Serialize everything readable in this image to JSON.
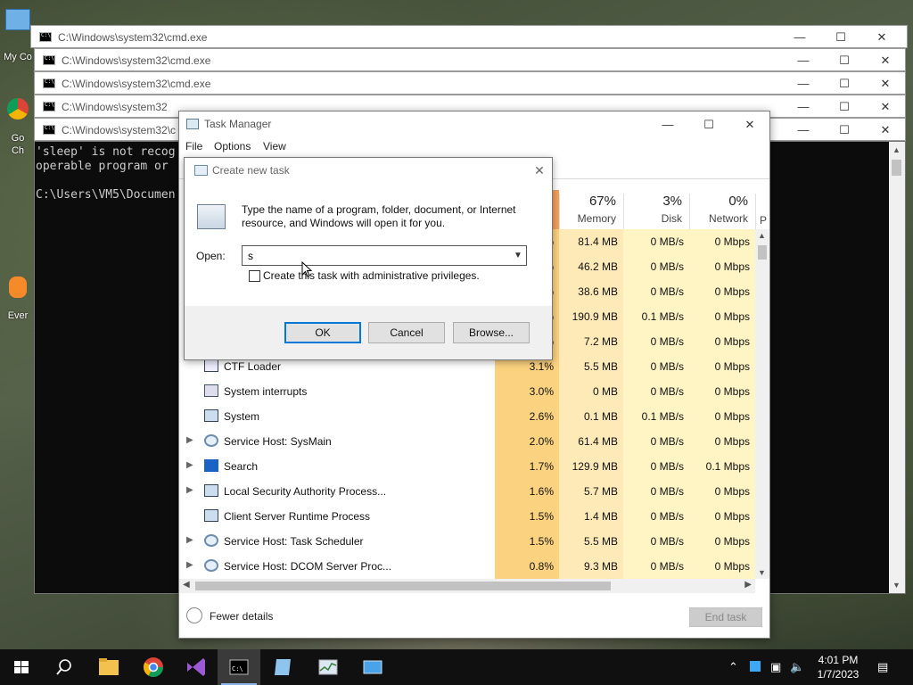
{
  "desktop": {
    "icons": [
      {
        "label": "My Co"
      },
      {
        "label": "Go\nCh"
      },
      {
        "label": "Ever"
      }
    ]
  },
  "cmd_windows": [
    {
      "title": "C:\\Windows\\system32\\cmd.exe"
    },
    {
      "title": "C:\\Windows\\system32\\cmd.exe"
    },
    {
      "title": "C:\\Windows\\system32\\cmd.exe"
    },
    {
      "title": "C:\\Windows\\system32"
    },
    {
      "title": "C:\\Windows\\system32\\c"
    }
  ],
  "cmd_output": {
    "line1": "'sleep' is not recog",
    "line2": "operable program or",
    "line3": "C:\\Users\\VM5\\Documen"
  },
  "task_manager": {
    "title": "Task Manager",
    "menu": [
      "File",
      "Options",
      "View"
    ],
    "columns": {
      "memory": {
        "pct": "67%",
        "label": "Memory"
      },
      "disk": {
        "pct": "3%",
        "label": "Disk"
      },
      "network": {
        "pct": "0%",
        "label": "Network"
      },
      "extra": {
        "label": "P"
      }
    },
    "partial_rows": [
      {
        "cpu": "%",
        "memory": "81.4 MB",
        "disk": "0 MB/s",
        "network": "0 Mbps"
      },
      {
        "cpu": "%",
        "memory": "46.2 MB",
        "disk": "0 MB/s",
        "network": "0 Mbps"
      },
      {
        "cpu": "%",
        "memory": "38.6 MB",
        "disk": "0 MB/s",
        "network": "0 Mbps"
      },
      {
        "cpu": "%",
        "memory": "190.9 MB",
        "disk": "0.1 MB/s",
        "network": "0 Mbps"
      },
      {
        "cpu": "%",
        "memory": "7.2 MB",
        "disk": "0 MB/s",
        "network": "0 Mbps"
      }
    ],
    "rows": [
      {
        "name": "CTF Loader",
        "cpu": "3.1%",
        "memory": "5.5 MB",
        "disk": "0 MB/s",
        "network": "0 Mbps"
      },
      {
        "name": "System interrupts",
        "cpu": "3.0%",
        "memory": "0 MB",
        "disk": "0 MB/s",
        "network": "0 Mbps"
      },
      {
        "name": "System",
        "cpu": "2.6%",
        "memory": "0.1 MB",
        "disk": "0.1 MB/s",
        "network": "0 Mbps"
      },
      {
        "name": "Service Host: SysMain",
        "cpu": "2.0%",
        "memory": "61.4 MB",
        "disk": "0 MB/s",
        "network": "0 Mbps"
      },
      {
        "name": "Search",
        "cpu": "1.7%",
        "memory": "129.9 MB",
        "disk": "0 MB/s",
        "network": "0.1 Mbps"
      },
      {
        "name": "Local Security Authority Process...",
        "cpu": "1.6%",
        "memory": "5.7 MB",
        "disk": "0 MB/s",
        "network": "0 Mbps"
      },
      {
        "name": "Client Server Runtime Process",
        "cpu": "1.5%",
        "memory": "1.4 MB",
        "disk": "0 MB/s",
        "network": "0 Mbps"
      },
      {
        "name": "Service Host: Task Scheduler",
        "cpu": "1.5%",
        "memory": "5.5 MB",
        "disk": "0 MB/s",
        "network": "0 Mbps"
      },
      {
        "name": "Service Host: DCOM Server Proc...",
        "cpu": "0.8%",
        "memory": "9.3 MB",
        "disk": "0 MB/s",
        "network": "0 Mbps"
      }
    ],
    "fewer_details": "Fewer details",
    "end_task": "End task"
  },
  "run_dialog": {
    "title": "Create new task",
    "description": "Type the name of a program, folder, document, or Internet resource, and Windows will open it for you.",
    "open_label": "Open:",
    "input_value": "s",
    "checkbox_label": "Create this task with administrative privileges.",
    "ok": "OK",
    "cancel": "Cancel",
    "browse": "Browse..."
  },
  "taskbar": {
    "time": "4:01 PM",
    "date": "1/7/2023"
  },
  "colors": {
    "cpu_heat": "#fbd27f",
    "memory_heat": "#fdeab7",
    "light_heat": "#fff4c4",
    "accent": "#0078d7",
    "taskbar": "#101010"
  }
}
